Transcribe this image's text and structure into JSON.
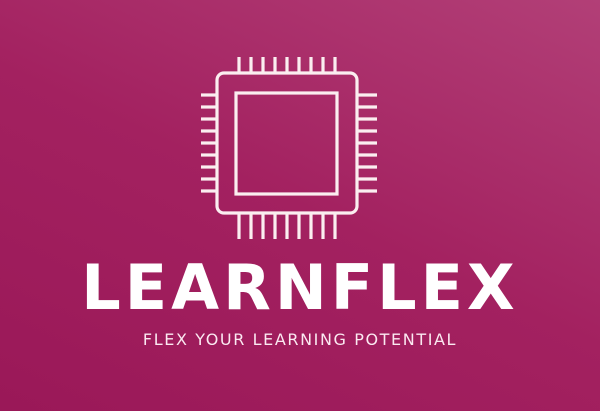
{
  "brand": {
    "name": "LEARNFLEX",
    "tagline": "FLEX YOUR LEARNING POTENTIAL"
  },
  "logo": {
    "icon": "microchip-icon",
    "stroke_color": "#fbeef0"
  },
  "colors": {
    "background_start": "#b23f77",
    "background_end": "#9a1858",
    "text": "#ffffff"
  }
}
